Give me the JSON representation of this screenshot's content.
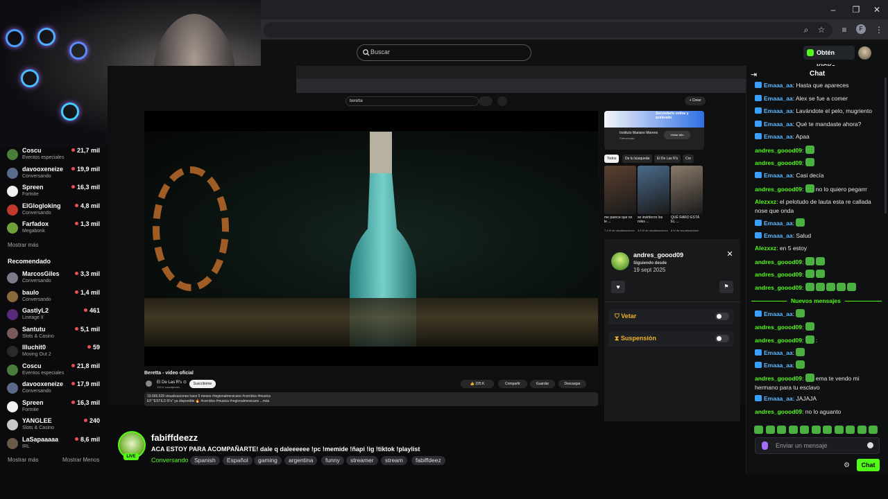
{
  "browser": {
    "controls": {
      "minimize": "–",
      "maximize": "❐",
      "close": "✕"
    },
    "profile_initial": "F"
  },
  "header": {
    "search_placeholder": "Buscar",
    "kicks_button": "Obtén KICKs"
  },
  "sidebar": {
    "following": [
      {
        "name": "Coscu",
        "category": "Eventos especiales",
        "viewers": "21,7 mil",
        "color": "#4b7d3a"
      },
      {
        "name": "davooxeneize",
        "category": "Conversando",
        "viewers": "19,9 mil",
        "color": "#5a6a8a"
      },
      {
        "name": "Spreen",
        "category": "Fortnite",
        "viewers": "16,3 mil",
        "color": "#f0f0f0"
      },
      {
        "name": "ElGlogloking",
        "category": "Conversando",
        "viewers": "4,8 mil",
        "color": "#c0392b"
      },
      {
        "name": "Farfadox",
        "category": "Megabonk",
        "viewers": "1,3 mil",
        "color": "#6fa13a"
      }
    ],
    "show_more": "Mostrar más",
    "recommended_heading": "Recomendado",
    "recommended": [
      {
        "name": "MarcosGiles",
        "category": "Conversando",
        "viewers": "3,3 mil",
        "color": "#7a7a8a"
      },
      {
        "name": "baulo",
        "category": "Conversando",
        "viewers": "1,4 mil",
        "color": "#8a6a3a"
      },
      {
        "name": "GastlyL2",
        "category": "Lineage II",
        "viewers": "461",
        "color": "#5a2a7a"
      },
      {
        "name": "Santutu",
        "category": "Slots & Casino",
        "viewers": "5,1 mil",
        "color": "#7a5a5a"
      },
      {
        "name": "Illuchit0",
        "category": "Moving Out 2",
        "viewers": "59",
        "color": "#2a2a2a"
      },
      {
        "name": "Coscu",
        "category": "Eventos especiales",
        "viewers": "21,8 mil",
        "color": "#4b7d3a"
      },
      {
        "name": "davooxeneize",
        "category": "Conversando",
        "viewers": "17,9 mil",
        "color": "#5a6a8a"
      },
      {
        "name": "Spreen",
        "category": "Fortnite",
        "viewers": "16,3 mil",
        "color": "#f0f0f0"
      },
      {
        "name": "YANGLEE",
        "category": "Slots & Casino",
        "viewers": "240",
        "color": "#c8c8c8"
      },
      {
        "name": "LaSapaaaaa",
        "category": "IRL",
        "viewers": "8,6 mil",
        "color": "#6a5a4a"
      }
    ],
    "show_more_bottom": "Mostrar más",
    "show_less": "Mostrar Menos"
  },
  "youtube": {
    "search_value": "beretta",
    "create_label": "+ Crear",
    "video_title": "Beretta - video oficial",
    "channel_name": "El De Las R's ⊙",
    "channel_subs": "193 K suscriptores",
    "subscribe_label": "Suscribirme",
    "likes": "225 K",
    "share_label": "Compartir",
    "save_label": "Guardar",
    "download_label": "Descargar",
    "desc_line1": "19.666.928 visualizaciones hace 5 meses #regionalmexicano #corridos #musica",
    "desc_line2": "EP \"ESTILO R's\" ya disponible 🔥 #corridos #musica #regionalmexicano ...más",
    "ad_headline": "Secundario online y acelerado",
    "ad_name": "Instituto Mariano Moreno",
    "ad_sponsored": "Patrocinado",
    "ad_button": "Visitar sitio",
    "chips": [
      "Todos",
      "De tu búsqueda",
      "El De Las R's",
      "Cre"
    ],
    "recs": [
      {
        "caption": "me parece que no le ...",
        "meta": "7,4 M de visualizaciones",
        "color": "#5a4030"
      },
      {
        "caption": "se invirtieron los roles ...",
        "meta": "3,5 M de visualizaciones",
        "color": "#4a6a8a"
      },
      {
        "caption": "QUÉ RARO ESTÁ EL ...",
        "meta": "8 M de visualizaciones",
        "color": "#8a7a6a"
      }
    ]
  },
  "mod_panel": {
    "username": "andres_goood09",
    "following_label": "Siguiendo desde",
    "following_date": "19 sept 2025",
    "veto_label": "Vetar",
    "suspension_label": "Suspensión"
  },
  "stream": {
    "streamer": "fabiffdeezz",
    "live_label": "LIVE",
    "title": "ACA ESTOY PARA ACOMPAÑARTE! dale q daleeeeee !pc !memide !ñapi !ig !tiktok !playlist",
    "category": "Conversando",
    "tags": [
      "Spanish",
      "Español",
      "gaming",
      "argentina",
      "funny",
      "streamer",
      "stream",
      "fabiffdeez"
    ]
  },
  "chat": {
    "title": "Chat",
    "messages": [
      {
        "user": "Emaaa_aa",
        "color": "blue",
        "badge": true,
        "text": "Hasta que apareces",
        "emotes": 0
      },
      {
        "user": "Emaaa_aa",
        "color": "blue",
        "badge": true,
        "text": "Alex se fue a comer",
        "emotes": 0
      },
      {
        "user": "Emaaa_aa",
        "color": "blue",
        "badge": true,
        "text": "Lavándote el pelo, mugriento",
        "emotes": 0
      },
      {
        "user": "Emaaa_aa",
        "color": "blue",
        "badge": true,
        "text": "Qué te mandaste ahora?",
        "emotes": 0
      },
      {
        "user": "Emaaa_aa",
        "color": "blue",
        "badge": true,
        "text": "Apaa",
        "emotes": 0
      },
      {
        "user": "andres_goood09",
        "color": "green",
        "badge": false,
        "text": "",
        "emotes": 1
      },
      {
        "user": "andres_goood09",
        "color": "green",
        "badge": false,
        "text": "",
        "emotes": 1
      },
      {
        "user": "Emaaa_aa",
        "color": "blue",
        "badge": true,
        "text": "Casi decía",
        "emotes": 0
      },
      {
        "user": "andres_goood09",
        "color": "green",
        "badge": false,
        "text": "no lo quiero pegarrr",
        "emotes": 1
      },
      {
        "user": "Alezxxz",
        "color": "green",
        "badge": false,
        "text": "el pelotudo de lauta esta re callada nose que onda",
        "emotes": 0
      },
      {
        "user": "Emaaa_aa",
        "color": "blue",
        "badge": true,
        "text": "",
        "emotes": 1
      },
      {
        "user": "Emaaa_aa",
        "color": "blue",
        "badge": true,
        "text": "Salud",
        "emotes": 0
      },
      {
        "user": "Alezxxz",
        "color": "green",
        "badge": false,
        "text": "en 5 estoy",
        "emotes": 0
      },
      {
        "user": "andres_goood09",
        "color": "green",
        "badge": false,
        "text": "",
        "emotes": 2
      },
      {
        "user": "andres_goood09",
        "color": "green",
        "badge": false,
        "text": "",
        "emotes": 2
      },
      {
        "user": "andres_goood09",
        "color": "green",
        "badge": false,
        "text": "",
        "emotes": 5
      }
    ],
    "new_messages_label": "Nuevos mensajes",
    "new_messages": [
      {
        "user": "Emaaa_aa",
        "color": "blue",
        "badge": true,
        "text": "",
        "emotes": 1
      },
      {
        "user": "andres_goood09",
        "color": "green",
        "badge": false,
        "text": "",
        "emotes": 1
      },
      {
        "user": "andres_goood09",
        "color": "green",
        "badge": false,
        "text": ":",
        "emotes": 1
      },
      {
        "user": "Emaaa_aa",
        "color": "blue",
        "badge": true,
        "text": "",
        "emotes": 1
      },
      {
        "user": "Emaaa_aa",
        "color": "blue",
        "badge": true,
        "text": "",
        "emotes": 1
      },
      {
        "user": "andres_goood09",
        "color": "green",
        "badge": false,
        "text": "ema te vendo mi hermano para tu esclavo",
        "emotes": 1
      },
      {
        "user": "Emaaa_aa",
        "color": "blue",
        "badge": true,
        "text": "JAJAJA",
        "emotes": 0
      },
      {
        "user": "andres_goood09",
        "color": "green",
        "badge": false,
        "text": "no lo aguanto",
        "emotes": 0
      }
    ],
    "input_placeholder": "Enviar un mensaje",
    "send_label": "Chat"
  }
}
